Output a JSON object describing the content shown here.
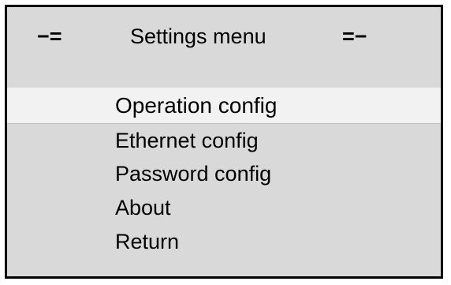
{
  "title": {
    "left_decoration": "−=",
    "text": "Settings menu",
    "right_decoration": "=−"
  },
  "menu": {
    "items": [
      {
        "label": "Operation config",
        "selected": true
      },
      {
        "label": "Ethernet config",
        "selected": false
      },
      {
        "label": "Password config",
        "selected": false
      },
      {
        "label": "About",
        "selected": false
      },
      {
        "label": "Return",
        "selected": false
      }
    ]
  },
  "colors": {
    "background": "#d9d9d9",
    "selected_row": "#f2f2f2",
    "border": "#000000",
    "text": "#000000"
  }
}
